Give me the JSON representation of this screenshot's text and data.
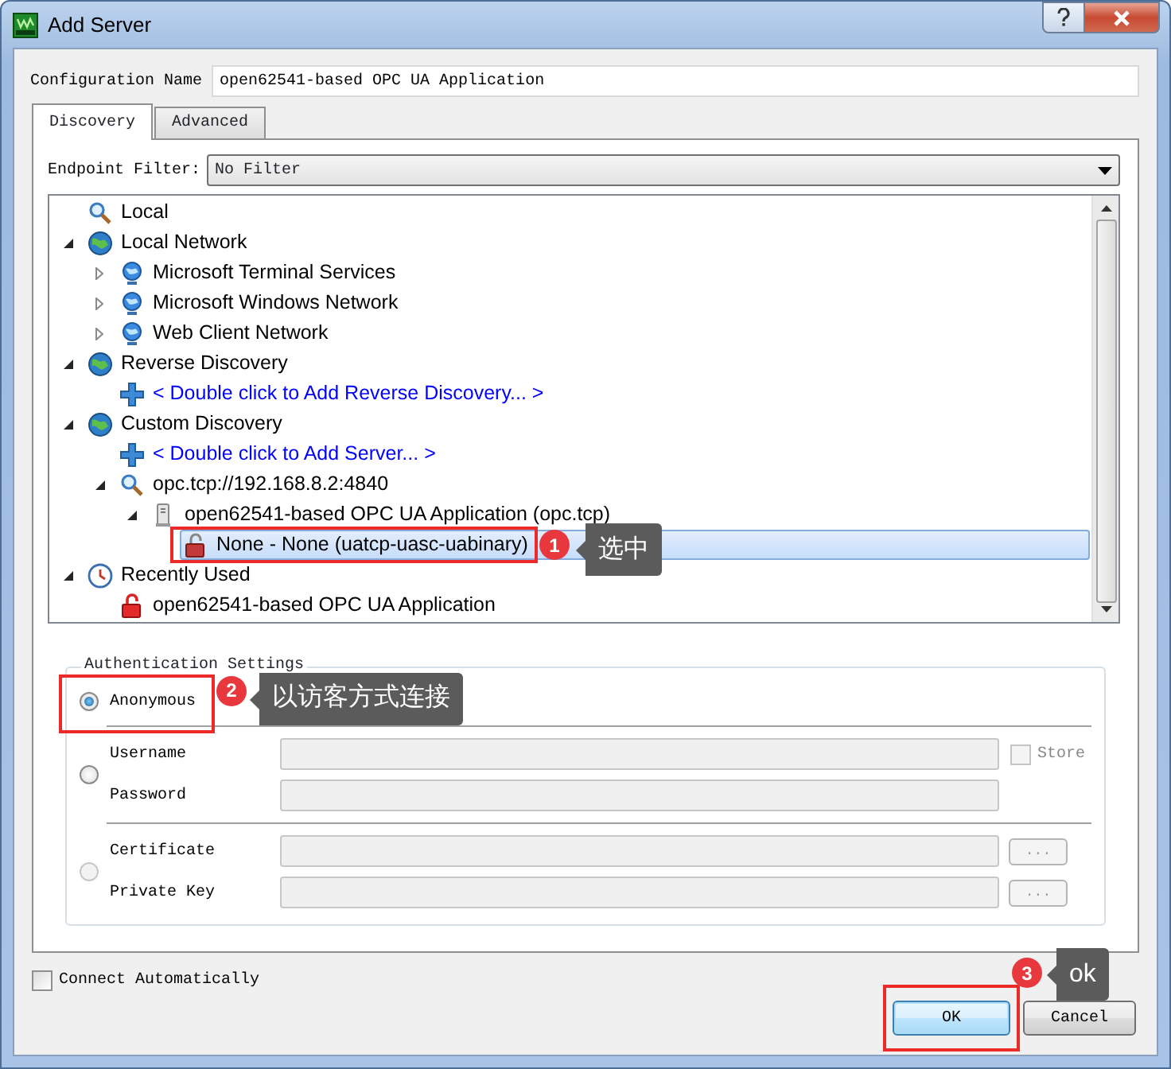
{
  "window": {
    "title": "Add Server"
  },
  "config": {
    "label": "Configuration Name",
    "value": "open62541-based OPC UA Application"
  },
  "tabs": [
    {
      "label": "Discovery",
      "selected": true
    },
    {
      "label": "Advanced",
      "selected": false
    }
  ],
  "endpoint_filter": {
    "label": "Endpoint Filter:",
    "value": "No Filter"
  },
  "tree": [
    {
      "label": "Local",
      "kind": "local"
    },
    {
      "label": "Local Network",
      "kind": "group",
      "expanded": true,
      "children": [
        {
          "label": "Microsoft Terminal Services",
          "kind": "host",
          "expanded": false
        },
        {
          "label": "Microsoft Windows Network",
          "kind": "host",
          "expanded": false
        },
        {
          "label": "Web Client Network",
          "kind": "host",
          "expanded": false
        }
      ]
    },
    {
      "label": "Reverse Discovery",
      "kind": "group",
      "expanded": true,
      "children": [
        {
          "label": "< Double click to Add Reverse Discovery... >",
          "kind": "action"
        }
      ]
    },
    {
      "label": "Custom Discovery",
      "kind": "group",
      "expanded": true,
      "children": [
        {
          "label": "< Double click to Add Server... >",
          "kind": "action"
        },
        {
          "label": "opc.tcp://192.168.8.2:4840",
          "kind": "url",
          "expanded": true,
          "children": [
            {
              "label": "open62541-based OPC UA Application (opc.tcp)",
              "kind": "server",
              "expanded": true,
              "children": [
                {
                  "label": "None - None (uatcp-uasc-uabinary)",
                  "kind": "endpoint",
                  "selected": true,
                  "callout": {
                    "number": "1",
                    "text": "选中"
                  }
                }
              ]
            }
          ]
        }
      ]
    },
    {
      "label": "Recently Used",
      "kind": "history",
      "expanded": true,
      "children": [
        {
          "label": "open62541-based OPC UA Application",
          "kind": "recent"
        }
      ]
    }
  ],
  "auth": {
    "title": "Authentication Settings",
    "options": [
      {
        "kind": "anonymous",
        "label": "Anonymous",
        "selected": true,
        "disabled": false,
        "callout": {
          "number": "2",
          "text": "以访客方式连接"
        }
      },
      {
        "kind": "credentials",
        "selected": false,
        "disabled": false,
        "fields": [
          {
            "label": "Username"
          },
          {
            "label": "Password"
          }
        ],
        "store": {
          "label": "Store",
          "checked": false
        }
      },
      {
        "kind": "certificate",
        "selected": false,
        "disabled": true,
        "fields": [
          {
            "label": "Certificate",
            "browse": "..."
          },
          {
            "label": "Private Key",
            "browse": "..."
          }
        ]
      }
    ]
  },
  "connect_automatically": {
    "label": "Connect Automatically",
    "checked": false
  },
  "buttons": [
    {
      "label": "OK",
      "default": true,
      "callout": {
        "number": "3",
        "text": "ok"
      }
    },
    {
      "label": "Cancel",
      "default": false
    }
  ]
}
